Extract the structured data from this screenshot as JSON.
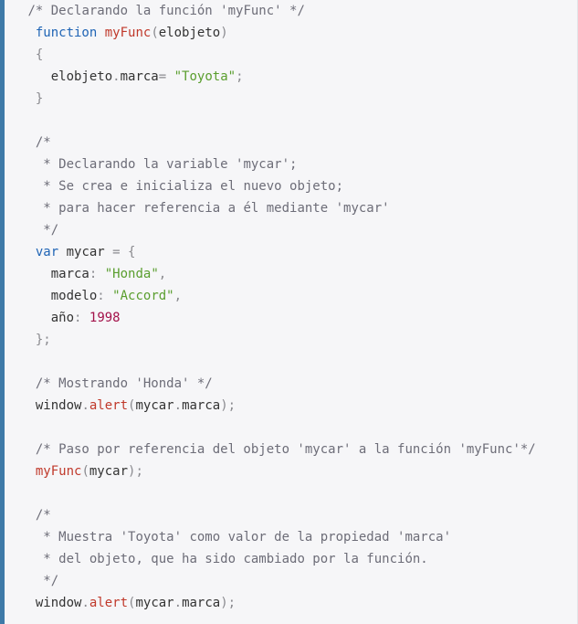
{
  "colors": {
    "background": "#f6f6f8",
    "left_border": "#3e7aa8",
    "comment": "#6d6d78",
    "keyword": "#1f64b5",
    "function": "#c0392b",
    "string": "#5a9e2e",
    "number": "#a3124a",
    "punctuation": "#8a8a8f",
    "text": "#333333"
  },
  "code_lines": [
    {
      "indent": " ",
      "tokens": [
        {
          "t": "comment",
          "v": "/* Declarando la función 'myFunc' */"
        }
      ]
    },
    {
      "indent": "  ",
      "tokens": [
        {
          "t": "keyword",
          "v": "function"
        },
        {
          "t": "plain",
          "v": " "
        },
        {
          "t": "function",
          "v": "myFunc"
        },
        {
          "t": "punct",
          "v": "("
        },
        {
          "t": "plain",
          "v": "elobjeto"
        },
        {
          "t": "punct",
          "v": ")"
        }
      ]
    },
    {
      "indent": "  ",
      "tokens": [
        {
          "t": "punct",
          "v": "{"
        }
      ]
    },
    {
      "indent": "    ",
      "tokens": [
        {
          "t": "plain",
          "v": "elobjeto"
        },
        {
          "t": "punct",
          "v": "."
        },
        {
          "t": "plain",
          "v": "marca"
        },
        {
          "t": "punct",
          "v": "="
        },
        {
          "t": "plain",
          "v": " "
        },
        {
          "t": "string",
          "v": "\"Toyota\""
        },
        {
          "t": "punct",
          "v": ";"
        }
      ]
    },
    {
      "indent": "  ",
      "tokens": [
        {
          "t": "punct",
          "v": "}"
        }
      ]
    },
    {
      "indent": "",
      "tokens": []
    },
    {
      "indent": "  ",
      "tokens": [
        {
          "t": "comment",
          "v": "/*"
        }
      ]
    },
    {
      "indent": "   ",
      "tokens": [
        {
          "t": "comment",
          "v": "* Declarando la variable 'mycar';"
        }
      ]
    },
    {
      "indent": "   ",
      "tokens": [
        {
          "t": "comment",
          "v": "* Se crea e inicializa el nuevo objeto;"
        }
      ]
    },
    {
      "indent": "   ",
      "tokens": [
        {
          "t": "comment",
          "v": "* para hacer referencia a él mediante 'mycar'"
        }
      ]
    },
    {
      "indent": "   ",
      "tokens": [
        {
          "t": "comment",
          "v": "*/"
        }
      ]
    },
    {
      "indent": "  ",
      "tokens": [
        {
          "t": "keyword",
          "v": "var"
        },
        {
          "t": "plain",
          "v": " mycar "
        },
        {
          "t": "punct",
          "v": "="
        },
        {
          "t": "plain",
          "v": " "
        },
        {
          "t": "punct",
          "v": "{"
        }
      ]
    },
    {
      "indent": "    ",
      "tokens": [
        {
          "t": "plain",
          "v": "marca"
        },
        {
          "t": "punct",
          "v": ":"
        },
        {
          "t": "plain",
          "v": " "
        },
        {
          "t": "string",
          "v": "\"Honda\""
        },
        {
          "t": "punct",
          "v": ","
        }
      ]
    },
    {
      "indent": "    ",
      "tokens": [
        {
          "t": "plain",
          "v": "modelo"
        },
        {
          "t": "punct",
          "v": ":"
        },
        {
          "t": "plain",
          "v": " "
        },
        {
          "t": "string",
          "v": "\"Accord\""
        },
        {
          "t": "punct",
          "v": ","
        }
      ]
    },
    {
      "indent": "    ",
      "tokens": [
        {
          "t": "plain",
          "v": "año"
        },
        {
          "t": "punct",
          "v": ":"
        },
        {
          "t": "plain",
          "v": " "
        },
        {
          "t": "number",
          "v": "1998"
        }
      ]
    },
    {
      "indent": "  ",
      "tokens": [
        {
          "t": "punct",
          "v": "};"
        }
      ]
    },
    {
      "indent": "",
      "tokens": []
    },
    {
      "indent": "  ",
      "tokens": [
        {
          "t": "comment",
          "v": "/* Mostrando 'Honda' */"
        }
      ]
    },
    {
      "indent": "  ",
      "tokens": [
        {
          "t": "plain",
          "v": "window"
        },
        {
          "t": "punct",
          "v": "."
        },
        {
          "t": "function",
          "v": "alert"
        },
        {
          "t": "punct",
          "v": "("
        },
        {
          "t": "plain",
          "v": "mycar"
        },
        {
          "t": "punct",
          "v": "."
        },
        {
          "t": "plain",
          "v": "marca"
        },
        {
          "t": "punct",
          "v": ");"
        }
      ]
    },
    {
      "indent": "",
      "tokens": []
    },
    {
      "indent": "  ",
      "tokens": [
        {
          "t": "comment",
          "v": "/* Paso por referencia del objeto 'mycar' a la función 'myFunc'*/"
        }
      ]
    },
    {
      "indent": "  ",
      "tokens": [
        {
          "t": "function",
          "v": "myFunc"
        },
        {
          "t": "punct",
          "v": "("
        },
        {
          "t": "plain",
          "v": "mycar"
        },
        {
          "t": "punct",
          "v": ");"
        }
      ]
    },
    {
      "indent": "",
      "tokens": []
    },
    {
      "indent": "  ",
      "tokens": [
        {
          "t": "comment",
          "v": "/*"
        }
      ]
    },
    {
      "indent": "   ",
      "tokens": [
        {
          "t": "comment",
          "v": "* Muestra 'Toyota' como valor de la propiedad 'marca'"
        }
      ]
    },
    {
      "indent": "   ",
      "tokens": [
        {
          "t": "comment",
          "v": "* del objeto, que ha sido cambiado por la función."
        }
      ]
    },
    {
      "indent": "   ",
      "tokens": [
        {
          "t": "comment",
          "v": "*/"
        }
      ]
    },
    {
      "indent": "  ",
      "tokens": [
        {
          "t": "plain",
          "v": "window"
        },
        {
          "t": "punct",
          "v": "."
        },
        {
          "t": "function",
          "v": "alert"
        },
        {
          "t": "punct",
          "v": "("
        },
        {
          "t": "plain",
          "v": "mycar"
        },
        {
          "t": "punct",
          "v": "."
        },
        {
          "t": "plain",
          "v": "marca"
        },
        {
          "t": "punct",
          "v": ");"
        }
      ]
    }
  ]
}
